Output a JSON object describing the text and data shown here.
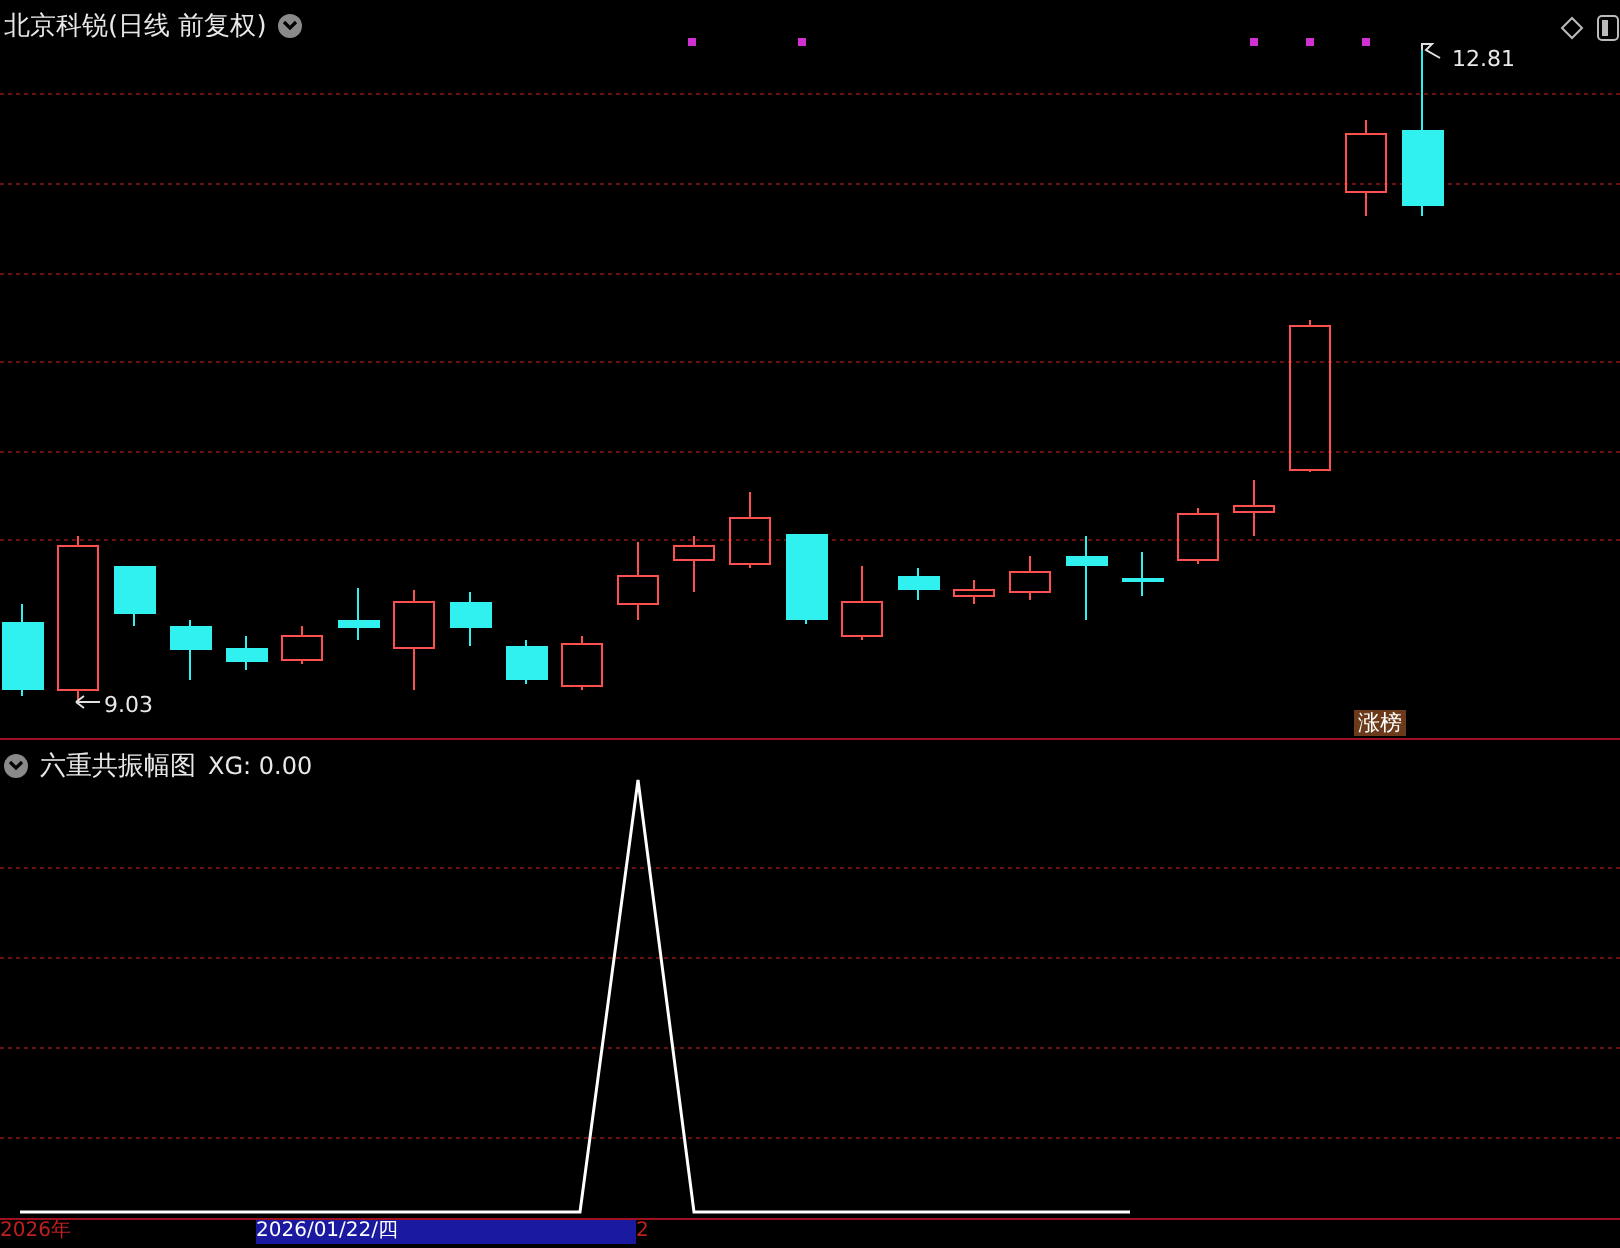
{
  "main_panel": {
    "title": "北京科锐(日线 前复权)",
    "high_label": "12.81",
    "low_label": "9.03",
    "badge": "涨榜"
  },
  "indicator_panel": {
    "title": "六重共振幅图",
    "reading": "XG: 0.00"
  },
  "time_axis": [
    "2026年",
    "2026/01/22/四",
    "2"
  ]
}
